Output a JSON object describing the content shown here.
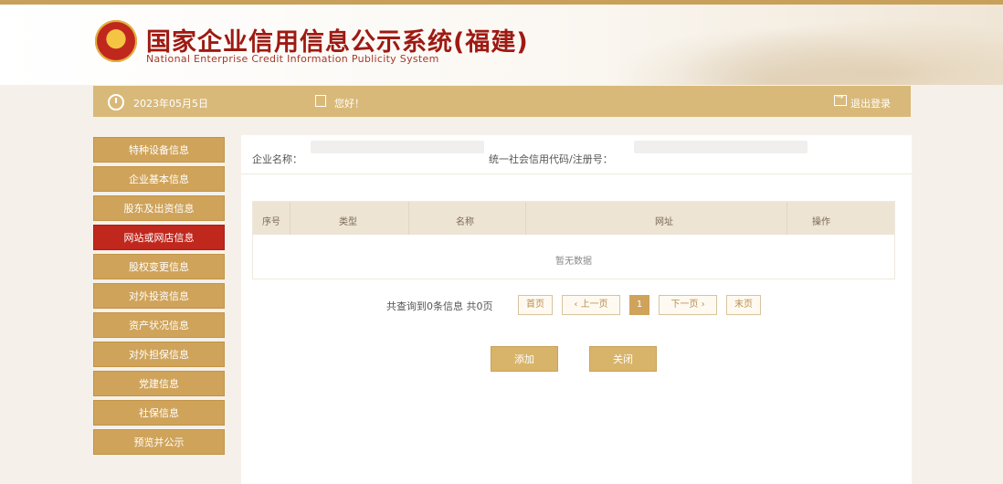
{
  "header": {
    "title_cn": "国家企业信用信息公示系统(福建)",
    "title_en": "National Enterprise Credit Information Publicity System"
  },
  "toolbar": {
    "date": "2023年05月5日",
    "greeting": "您好！",
    "logout_label": "退出登录"
  },
  "sidebar": {
    "items": [
      {
        "label": "特种设备信息"
      },
      {
        "label": "企业基本信息"
      },
      {
        "label": "股东及出资信息"
      },
      {
        "label": "网站或网店信息"
      },
      {
        "label": "股权变更信息"
      },
      {
        "label": "对外投资信息"
      },
      {
        "label": "资产状况信息"
      },
      {
        "label": "对外担保信息"
      },
      {
        "label": "党建信息"
      },
      {
        "label": "社保信息"
      },
      {
        "label": "预览并公示"
      }
    ],
    "active_index": 3
  },
  "form": {
    "company_name_label": "企业名称：",
    "credit_code_label": "统一社会信用代码/注册号："
  },
  "table": {
    "columns": [
      "序号",
      "类型",
      "名称",
      "网址",
      "操作"
    ],
    "empty_text": "暂无数据"
  },
  "pagination": {
    "info": "共查询到0条信息  共0页",
    "first": "首页",
    "prev": "‹ 上一页",
    "current": "1",
    "next": "下一页 ›",
    "last": "末页"
  },
  "actions": {
    "add_label": "添加",
    "close_label": "关闭"
  },
  "colors": {
    "accent_gold": "#cfa35a",
    "active_red": "#c0271d",
    "title_red": "#9e1a12"
  }
}
